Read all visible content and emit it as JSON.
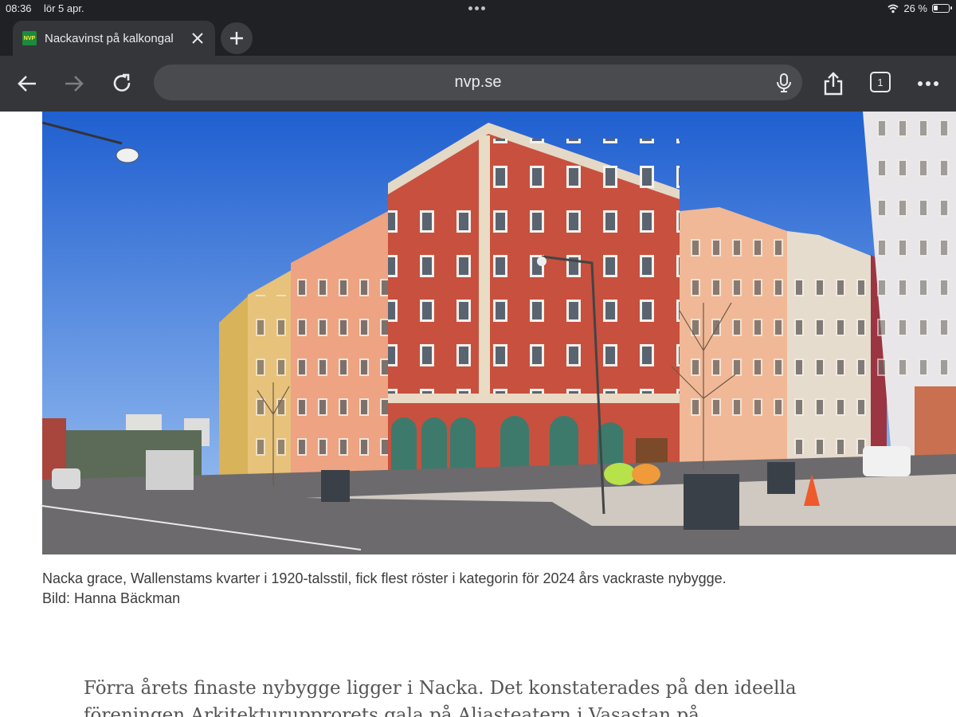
{
  "status_bar": {
    "time": "08:36",
    "date": "lör 5 apr.",
    "battery": "26 %",
    "battery_level": 0.26,
    "wifi_icon": "wifi-icon"
  },
  "tab": {
    "favicon_text": "NVP",
    "title": "Nackavinst på kalkongal",
    "close_icon": "close-icon"
  },
  "toolbar": {
    "back_icon": "back-arrow-icon",
    "forward_icon": "forward-arrow-icon",
    "reload_icon": "reload-icon",
    "url": "nvp.se",
    "mic_icon": "microphone-icon",
    "share_icon": "share-icon",
    "tab_count": "1",
    "menu_icon": "more-horizontal-icon"
  },
  "article": {
    "image_alt": "Photo of red and orange apartment buildings on a street corner under blue sky",
    "caption": "Nacka grace, Wallenstams kvarter i 1920-talsstil, fick flest röster i kategorin för 2024 års vackraste nybygge.",
    "photo_credit": "Bild: Hanna Bäckman",
    "lead_line1": "Förra årets finaste nybygge ligger i Nacka. Det konstaterades på den ideella",
    "lead_line2": "föreningen Arkitekturupprorets gala på Aliasteatern i Vasastan på"
  },
  "colors": {
    "chrome_dark": "#202124",
    "chrome_toolbar": "#35363a",
    "omnibox": "#4a4b4f",
    "sky": "#2f6fd8",
    "brick_red": "#c65042",
    "salmon": "#e9a27e"
  }
}
